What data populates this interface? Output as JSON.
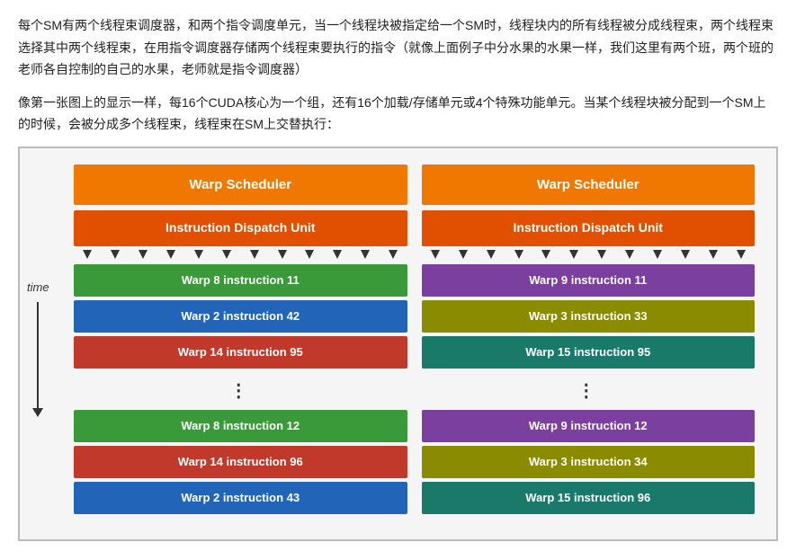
{
  "text": {
    "paragraph1": "每个SM有两个线程束调度器，和两个指令调度单元，当一个线程块被指定给一个SM时，线程块内的所有线程被分成线程束，两个线程束选择其中两个线程束，在用指令调度器存储两个线程束要执行的指令（就像上面例子中分水果的水果一样，我们这里有两个班，两个班的老师各自控制的自己的水果，老师就是指令调度器）",
    "paragraph2": "像第一张图上的显示一样，每16个CUDA核心为一个组，还有16个加载/存储单元或4个特殊功能单元。当某个线程块被分配到一个SM上的时候，会被分成多个线程束，线程束在SM上交替执行："
  },
  "diagram": {
    "time_label": "time",
    "left_column": {
      "scheduler_label": "Warp Scheduler",
      "dispatch_label": "Instruction Dispatch Unit",
      "instructions": [
        {
          "text": "Warp 8 instruction 11",
          "color": "green"
        },
        {
          "text": "Warp 2 instruction 42",
          "color": "blue"
        },
        {
          "text": "Warp 14 instruction 95",
          "color": "red"
        },
        {
          "text": "⋮",
          "type": "dots"
        },
        {
          "text": "Warp 8 instruction 12",
          "color": "green"
        },
        {
          "text": "Warp 14 instruction 96",
          "color": "red"
        },
        {
          "text": "Warp 2 instruction 43",
          "color": "blue"
        }
      ]
    },
    "right_column": {
      "scheduler_label": "Warp Scheduler",
      "dispatch_label": "Instruction Dispatch Unit",
      "instructions": [
        {
          "text": "Warp 9 instruction 11",
          "color": "purple"
        },
        {
          "text": "Warp 3 instruction 33",
          "color": "olive"
        },
        {
          "text": "Warp 15 instruction 95",
          "color": "teal"
        },
        {
          "text": "⋮",
          "type": "dots"
        },
        {
          "text": "Warp 9 instruction 12",
          "color": "purple"
        },
        {
          "text": "Warp 3 instruction 34",
          "color": "olive"
        },
        {
          "text": "Warp 15 instruction 96",
          "color": "teal"
        }
      ]
    }
  }
}
